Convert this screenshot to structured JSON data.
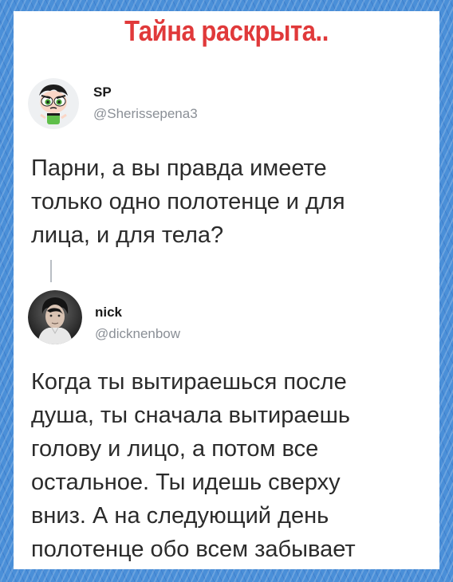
{
  "headline": "Тайна раскрыта..",
  "tweet1": {
    "name": "SP",
    "handle": "@Sherissepena3",
    "avatar_icon": "powerpuff-buttercup-avatar-icon",
    "lines": [
      "Парни, а вы правда имеете",
      "только одно полотенце и для",
      "лица, и для тела?"
    ]
  },
  "tweet2": {
    "name": "nick",
    "handle": "@dicknenbow",
    "avatar_icon": "person-photo-avatar-icon",
    "lines": [
      "Когда ты вытираешься после",
      "душа, ты сначала вытираешь",
      "голову и лицо, а потом все",
      "остальное. Ты идешь сверху",
      "вниз. А на следующий день",
      "полотенце обо всем забывает"
    ]
  },
  "colors": {
    "headline": "#e0393a",
    "background": "#4a8fd8",
    "handle": "#8a8f96"
  }
}
